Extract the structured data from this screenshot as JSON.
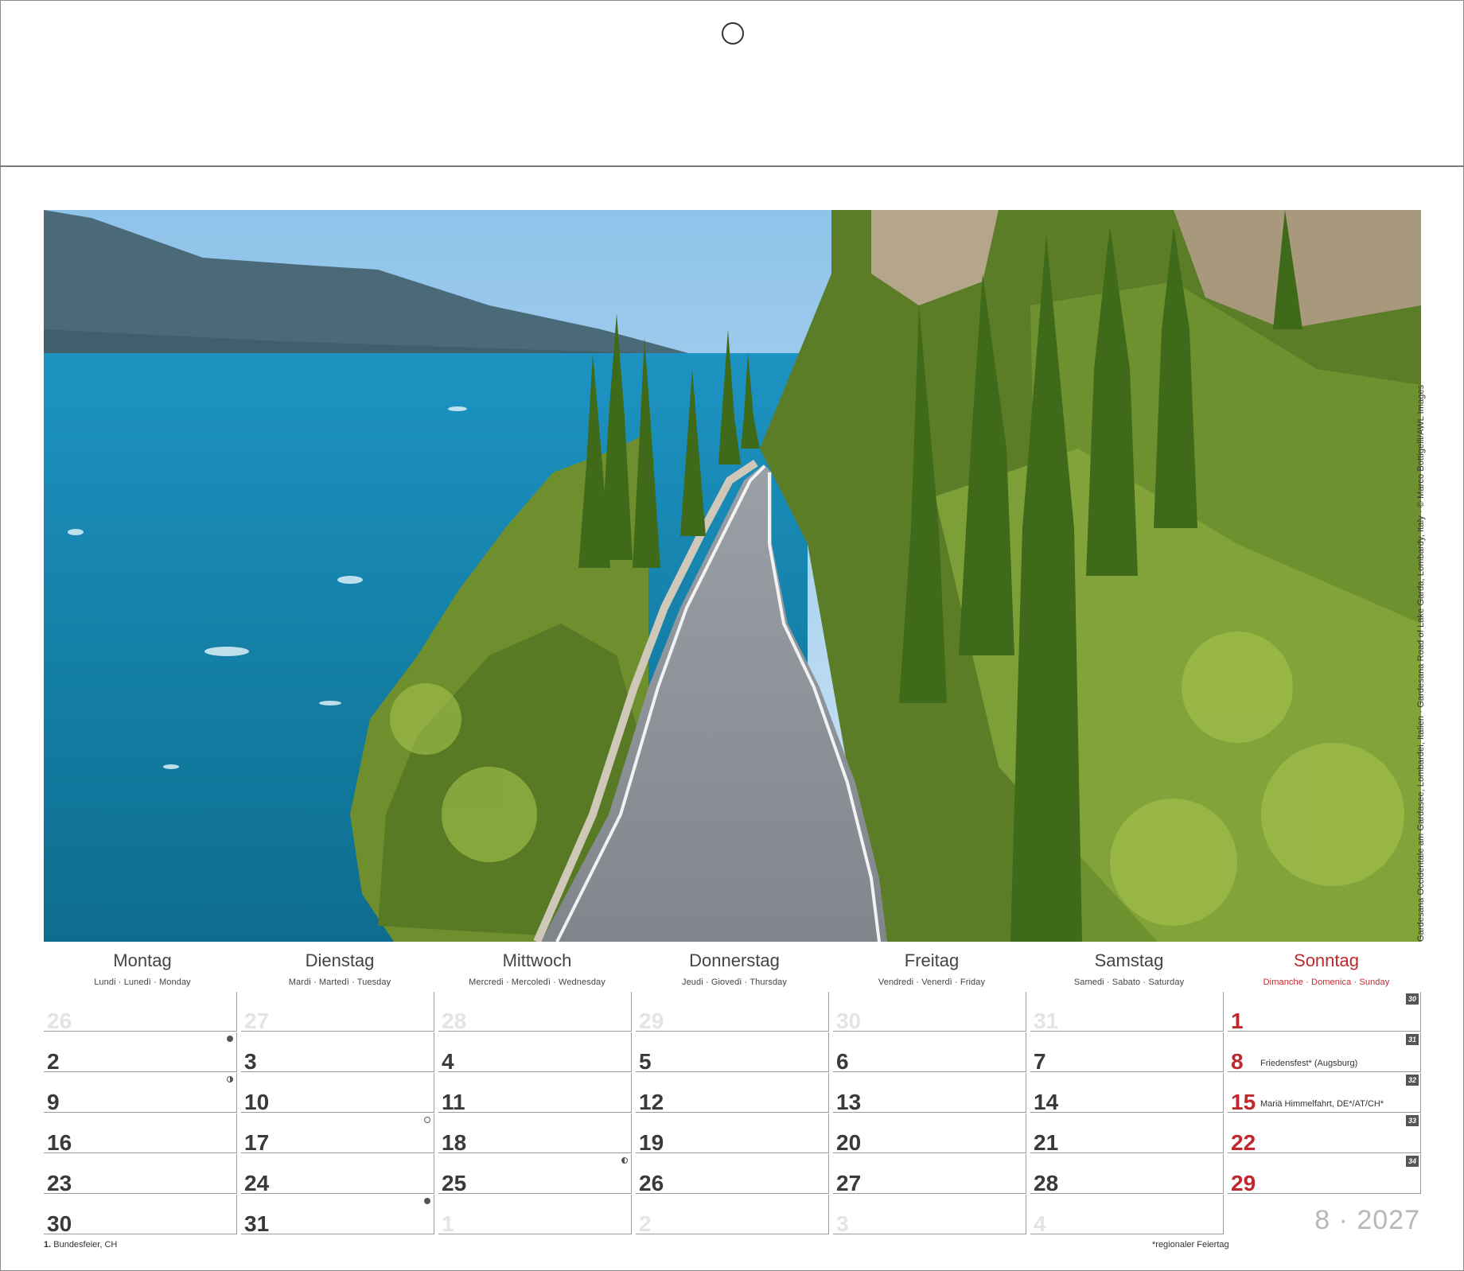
{
  "photo": {
    "alt": "Gardesana Occidentale road along Lake Garda with cypress trees",
    "credit": "Gardesana Occidentale am Gardasee, Lombardei, Italien · Gardesana Road of Lake Garda, Lombardy, Italy · © Marco Bottigelli/AWL Images"
  },
  "weekdays": [
    {
      "name": "Montag",
      "sub": "Lundi · Lunedì · Monday"
    },
    {
      "name": "Dienstag",
      "sub": "Mardi · Martedì · Tuesday"
    },
    {
      "name": "Mittwoch",
      "sub": "Mercredi · Mercoledì · Wednesday"
    },
    {
      "name": "Donnerstag",
      "sub": "Jeudi · Giovedì · Thursday"
    },
    {
      "name": "Freitag",
      "sub": "Vendredi · Venerdì · Friday"
    },
    {
      "name": "Samstag",
      "sub": "Samedi · Sabato · Saturday"
    },
    {
      "name": "Sonntag",
      "sub": "Dimanche · Domenica · Sunday"
    }
  ],
  "weeks": [
    {
      "week": "30",
      "days": [
        {
          "d": "26",
          "pad": true
        },
        {
          "d": "27",
          "pad": true
        },
        {
          "d": "28",
          "pad": true
        },
        {
          "d": "29",
          "pad": true
        },
        {
          "d": "30",
          "pad": true
        },
        {
          "d": "31",
          "pad": true
        },
        {
          "d": "1"
        }
      ]
    },
    {
      "week": "31",
      "days": [
        {
          "d": "2",
          "moon": "new"
        },
        {
          "d": "3"
        },
        {
          "d": "4"
        },
        {
          "d": "5"
        },
        {
          "d": "6"
        },
        {
          "d": "7"
        },
        {
          "d": "8",
          "holiday": "Friedensfest* (Augsburg)"
        }
      ]
    },
    {
      "week": "32",
      "days": [
        {
          "d": "9",
          "moon": "first"
        },
        {
          "d": "10"
        },
        {
          "d": "11"
        },
        {
          "d": "12"
        },
        {
          "d": "13"
        },
        {
          "d": "14"
        },
        {
          "d": "15",
          "holiday": "Mariä Himmelfahrt, DE*/AT/CH*"
        }
      ]
    },
    {
      "week": "33",
      "days": [
        {
          "d": "16"
        },
        {
          "d": "17",
          "moon": "full"
        },
        {
          "d": "18"
        },
        {
          "d": "19"
        },
        {
          "d": "20"
        },
        {
          "d": "21"
        },
        {
          "d": "22"
        }
      ]
    },
    {
      "week": "34",
      "days": [
        {
          "d": "23"
        },
        {
          "d": "24"
        },
        {
          "d": "25",
          "moon": "last"
        },
        {
          "d": "26"
        },
        {
          "d": "27"
        },
        {
          "d": "28"
        },
        {
          "d": "29"
        }
      ]
    },
    {
      "week": "",
      "days": [
        {
          "d": "30"
        },
        {
          "d": "31",
          "moon": "new"
        },
        {
          "d": "1",
          "pad": true
        },
        {
          "d": "2",
          "pad": true
        },
        {
          "d": "3",
          "pad": true
        },
        {
          "d": "4",
          "pad": true
        }
      ]
    }
  ],
  "month_year": "8 · 2027",
  "footnotes": {
    "left_day": "1.",
    "left_text": " Bundesfeier, CH",
    "right": "*regionaler Feiertag"
  },
  "colors": {
    "sunday": "#c0282d",
    "text": "#333333",
    "pad": "#e4e4e4"
  }
}
